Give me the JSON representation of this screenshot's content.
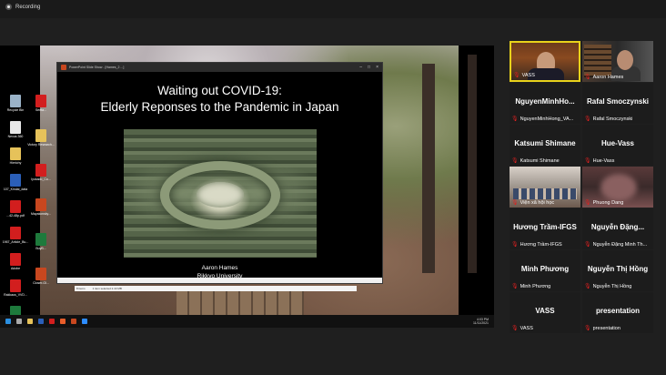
{
  "recording": {
    "label": "Recording"
  },
  "ppt_window": {
    "title": "PowerPoint Slide Show - [Hames_2 ...]",
    "slide_title_line1": "Waiting out COVID-19:",
    "slide_title_line2": "Elderly Reponses to the Pandemic in Japan",
    "author": "Aaron Hames",
    "affiliation": "Rikkyo University"
  },
  "desktop_icons": [
    {
      "label": "Recycle Bin",
      "type": "bin"
    },
    {
      "label": "Nexus 360",
      "type": "wht"
    },
    {
      "label": "Hierichy",
      "type": "fld"
    },
    {
      "label": "107_Kindai_data",
      "type": "doc"
    },
    {
      "label": "...42-48p.pdf",
      "type": "pdf"
    },
    {
      "label": "1967_Article_Bu...",
      "type": "pdf"
    },
    {
      "label": "Adobe",
      "type": "pdf"
    },
    {
      "label": "Rakkaus_VVD...",
      "type": "pdf"
    },
    {
      "label": "ROADY-VCLS...",
      "type": "xls"
    },
    {
      "label": "WHO18_Population",
      "type": "pdf"
    }
  ],
  "desktop_icons_col2": [
    {
      "label": "Seeta...",
      "type": "pdf"
    },
    {
      "label": "Victory Research...",
      "type": "fld"
    },
    {
      "label": "Iyokado_Co...",
      "type": "pdf"
    },
    {
      "label": "Mayakovsky...",
      "type": "ppt"
    },
    {
      "label": "BuyB...",
      "type": "xls"
    },
    {
      "label": "Closer-Gl...",
      "type": "ppt"
    }
  ],
  "explorer_status": {
    "items": "8 items",
    "selected": "1 item selected  2.43 MB"
  },
  "taskbar": {
    "time": "4:03 PM",
    "date": "11/11/2021"
  },
  "participants": [
    {
      "display": "",
      "caption": "VASS",
      "video": "video1",
      "active": true
    },
    {
      "display": "",
      "caption": "Aaron Hames",
      "video": "video2",
      "active": false
    },
    {
      "display": "NguyenMinhHo...",
      "caption": "NguyenMinhHong_VA...",
      "video": "",
      "active": false
    },
    {
      "display": "Rafal Smoczynski",
      "caption": "Rafal Smoczynski",
      "video": "",
      "active": false
    },
    {
      "display": "Katsumi Shimane",
      "caption": "Katsumi Shimane",
      "video": "",
      "active": false
    },
    {
      "display": "Hue-Vass",
      "caption": "Hue-Vass",
      "video": "",
      "active": false
    },
    {
      "display": "",
      "caption": "Viện xã hội học",
      "video": "video3",
      "active": false
    },
    {
      "display": "",
      "caption": "Phuong Dang",
      "video": "video4",
      "active": false
    },
    {
      "display": "Hương Trầm-IFGS",
      "caption": "Hương Trầm-IFGS",
      "video": "",
      "active": false
    },
    {
      "display": "Nguyễn Đặng...",
      "caption": "Nguyễn Đặng Minh Th...",
      "video": "",
      "active": false
    },
    {
      "display": "Minh Phương",
      "caption": "Minh Phương",
      "video": "",
      "active": false
    },
    {
      "display": "Nguyễn Thị Hồng",
      "caption": "Nguyễn Thị Hồng",
      "video": "",
      "active": false
    },
    {
      "display": "VASS",
      "caption": "VASS",
      "video": "",
      "active": false
    },
    {
      "display": "presentation",
      "caption": "presentation",
      "video": "",
      "active": false
    }
  ]
}
